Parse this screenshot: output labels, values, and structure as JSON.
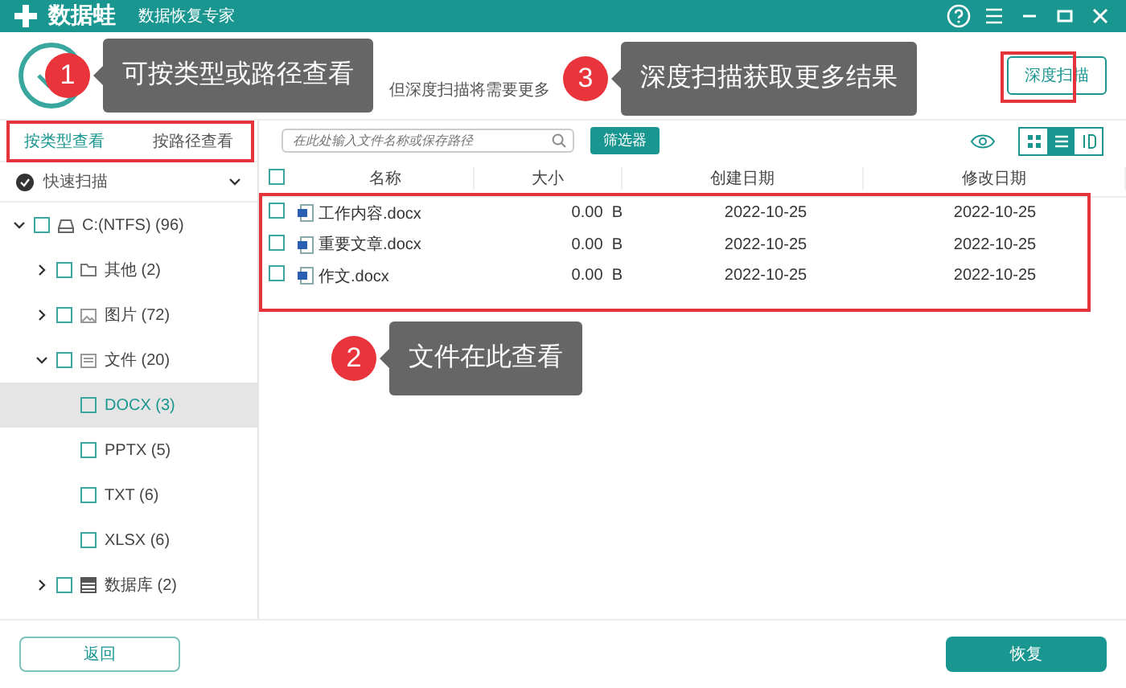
{
  "window": {
    "brand": "数据蛙",
    "subtitle": "数据恢复专家"
  },
  "status": {
    "line_2": "但深度扫描将需要更多"
  },
  "deep_scan_button": "深度扫描",
  "view_tabs": [
    {
      "label": "按类型查看",
      "selected": true
    },
    {
      "label": "按路径查看",
      "selected": false
    }
  ],
  "scan_mode": {
    "label": "快速扫描"
  },
  "tree": [
    {
      "label": "C:(NTFS) (96)",
      "kind": "drive",
      "expanded": true,
      "selected": false,
      "children": [
        {
          "label": "其他 (2)",
          "kind": "folder",
          "expanded": false,
          "selected": false
        },
        {
          "label": "图片 (72)",
          "kind": "image",
          "expanded": false,
          "selected": false
        },
        {
          "label": "文件 (20)",
          "kind": "doc",
          "expanded": true,
          "selected": false,
          "children": [
            {
              "label": "DOCX (3)",
              "kind": "type",
              "selected": true
            },
            {
              "label": "PPTX (5)",
              "kind": "type",
              "selected": false
            },
            {
              "label": "TXT (6)",
              "kind": "type",
              "selected": false
            },
            {
              "label": "XLSX (6)",
              "kind": "type",
              "selected": false
            }
          ]
        },
        {
          "label": "数据库 (2)",
          "kind": "database",
          "expanded": false,
          "selected": false
        }
      ]
    }
  ],
  "search": {
    "placeholder": "在此处输入文件名称或保存路径"
  },
  "filter_button": "筛选器",
  "view_modes": [
    {
      "kind": "grid",
      "selected": false
    },
    {
      "kind": "list",
      "selected": true
    },
    {
      "kind": "detail",
      "selected": false
    }
  ],
  "table": {
    "columns": [
      "名称",
      "大小",
      "创建日期",
      "修改日期"
    ],
    "select_all_checked": false,
    "rows": [
      {
        "checked": false,
        "name": "工作内容.docx",
        "size": "0.00  B",
        "created": "2022-10-25",
        "modified": "2022-10-25"
      },
      {
        "checked": false,
        "name": "重要文章.docx",
        "size": "0.00  B",
        "created": "2022-10-25",
        "modified": "2022-10-25"
      },
      {
        "checked": false,
        "name": "作文.docx",
        "size": "0.00  B",
        "created": "2022-10-25",
        "modified": "2022-10-25"
      }
    ]
  },
  "callouts": [
    {
      "number": "1",
      "text": "可按类型或路径查看"
    },
    {
      "number": "2",
      "text": "文件在此查看"
    },
    {
      "number": "3",
      "text": "深度扫描获取更多结果"
    }
  ],
  "back_button": "返回",
  "recover_button": "恢复"
}
